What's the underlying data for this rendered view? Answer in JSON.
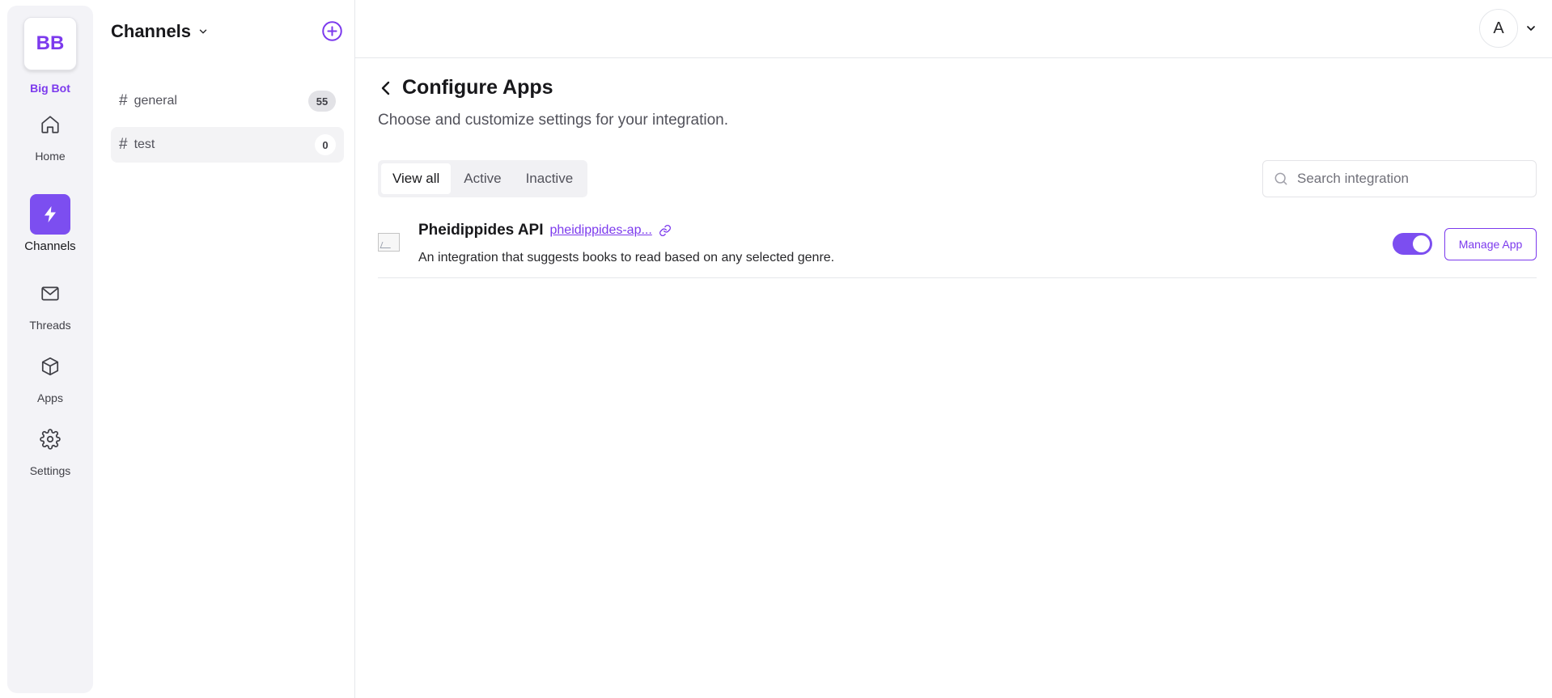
{
  "workspace": {
    "initials": "BB",
    "name": "Big Bot",
    "accent": "#7c3aed"
  },
  "rail": {
    "items": [
      {
        "label": "Home",
        "icon": "home-icon"
      },
      {
        "label": "Channels",
        "icon": "bolt-icon",
        "active": true
      },
      {
        "label": "Threads",
        "icon": "mail-icon"
      },
      {
        "label": "Apps",
        "icon": "cube-icon"
      },
      {
        "label": "Settings",
        "icon": "gear-icon"
      }
    ]
  },
  "channels": {
    "title": "Channels",
    "items": [
      {
        "name": "general",
        "count": "55"
      },
      {
        "name": "test",
        "count": "0",
        "selected": true
      }
    ]
  },
  "header": {
    "avatar_initial": "A"
  },
  "main": {
    "title": "Configure Apps",
    "subtitle": "Choose and customize settings for your integration.",
    "tabs": [
      {
        "label": "View all",
        "active": true
      },
      {
        "label": "Active"
      },
      {
        "label": "Inactive"
      }
    ],
    "search": {
      "placeholder": "Search integration",
      "value": ""
    },
    "apps": [
      {
        "name": "Pheidippides API",
        "link": "pheidippides-ap...",
        "description": "An integration that suggests books to read based on any selected genre.",
        "enabled": true,
        "manage_label": "Manage App"
      }
    ]
  }
}
